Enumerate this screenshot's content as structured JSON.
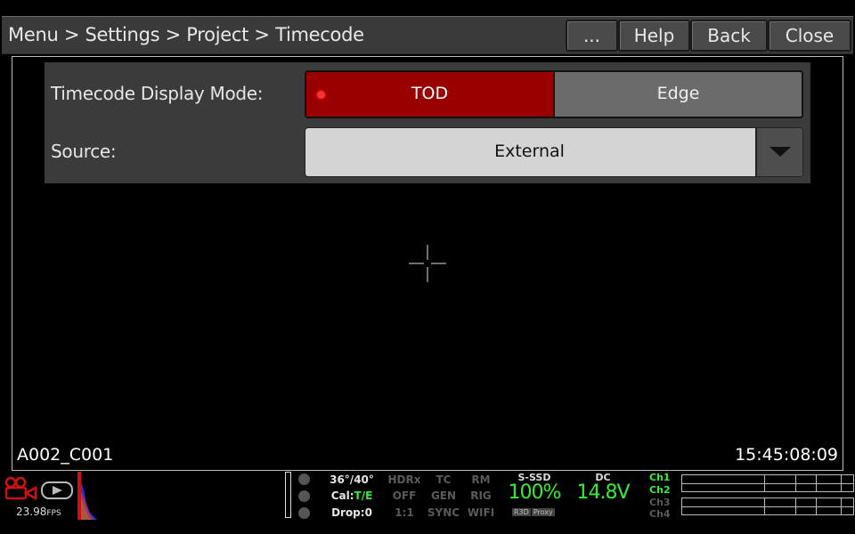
{
  "titlebar": {
    "breadcrumb": "Menu > Settings > Project > Timecode",
    "buttons": {
      "more": "...",
      "help": "Help",
      "back": "Back",
      "close": "Close"
    }
  },
  "settings": {
    "display_mode": {
      "label": "Timecode Display Mode:",
      "options": [
        "TOD",
        "Edge"
      ],
      "selected": "TOD"
    },
    "source": {
      "label": "Source:",
      "value": "External"
    }
  },
  "overlay": {
    "clip_name": "A002_C001",
    "timecode": "15:45:08:09"
  },
  "status": {
    "fps": "23.98",
    "fps_unit": "FPS",
    "shutter": "36°/40°",
    "cal_label": "Cal:",
    "cal_value": "T/E",
    "drop": "Drop:0",
    "hdrx": {
      "label": "HDRx",
      "value": "OFF",
      "sub": "1:1"
    },
    "tc": {
      "label": "TC",
      "value": "GEN",
      "sub": "SYNC"
    },
    "rm": {
      "label": "RM",
      "value": "RIG",
      "sub": "WIFI"
    },
    "media": {
      "label": "S-SSD",
      "value": "100%",
      "tags": [
        "R3D",
        "Proxy"
      ]
    },
    "power": {
      "label": "DC",
      "value": "14.8V"
    },
    "audio_channels": [
      "Ch1",
      "Ch2",
      "Ch3",
      "Ch4"
    ]
  },
  "colors": {
    "accent_red": "#990000",
    "status_green": "#33ee33",
    "panel_bg": "#3b3b3b"
  }
}
